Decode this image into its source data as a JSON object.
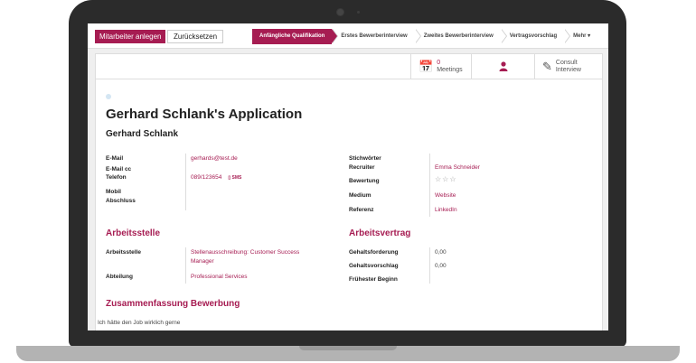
{
  "toolbar": {
    "create_label": "Mitarbeiter anlegen",
    "reset_label": "Zurücksetzen"
  },
  "stages": [
    {
      "label": "Anfängliche Qualifikation",
      "active": true
    },
    {
      "label": "Erstes Bewerberinterview",
      "active": false
    },
    {
      "label": "Zweites Bewerberinterview",
      "active": false
    },
    {
      "label": "Vertragsvorschlag",
      "active": false
    }
  ],
  "stages_more": "Mehr ▾",
  "smart_buttons": {
    "meetings_count": "0",
    "meetings_label": "Meetings",
    "consult_line1": "Consult",
    "consult_line2": "Interview"
  },
  "icons": {
    "calendar": "calendar-icon",
    "user": "user-icon",
    "edit": "edit-icon"
  },
  "applicant": {
    "title": "Gerhard Schlank's Application",
    "name": "Gerhard Schlank"
  },
  "contact": {
    "email_label": "E-Mail",
    "email_value": "gerhards@test.de",
    "email_cc_label": "E-Mail cc",
    "phone_label": "Telefon",
    "phone_value": "089/123654",
    "sms_label": "SMS",
    "mobile_label": "Mobil",
    "degree_label": "Abschluss"
  },
  "info": {
    "tags_label": "Stichwörter",
    "recruiter_label": "Recruiter",
    "recruiter_value": "Emma Schneider",
    "rating_label": "Bewertung",
    "rating_value": 0,
    "rating_max": 3,
    "medium_label": "Medium",
    "medium_value": "Website",
    "referral_label": "Referenz",
    "referral_value": "LinkedIn"
  },
  "job_section": {
    "title": "Arbeitsstelle",
    "position_label": "Arbeitsstelle",
    "position_value_line1": "Stellenausschreibung: Customer Success",
    "position_value_line2": "Manager",
    "department_label": "Abteilung",
    "department_value": "Professional Services"
  },
  "contract_section": {
    "title": "Arbeitsvertrag",
    "expected_label": "Gehaltsforderung",
    "expected_value": "0,00",
    "proposed_label": "Gehaltsvorschlag",
    "proposed_value": "0,00",
    "availability_label": "Frühester Beginn"
  },
  "summary_section": {
    "title": "Zusammenfassung Bewerbung",
    "text": "Ich hätte den Job wirklich gerne"
  },
  "colors": {
    "accent": "#a61c52",
    "laptop_body": "#2b2b2b",
    "laptop_base": "#b3b3b3"
  }
}
